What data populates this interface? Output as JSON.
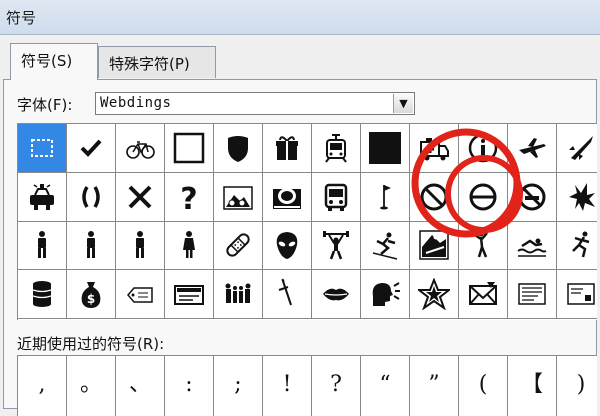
{
  "window": {
    "title": "符号"
  },
  "tabs": [
    {
      "label": "符号(S)",
      "active": true
    },
    {
      "label": "特殊字符(P)",
      "active": false
    }
  ],
  "font": {
    "label": "字体(F):",
    "value": "Webdings"
  },
  "grid": {
    "rows": [
      [
        "select-box",
        "check",
        "bicycle",
        "blank-square",
        "shield",
        "gift",
        "tram-car",
        "black-square",
        "ambulance",
        "info-circle",
        "airplane",
        "rocket",
        "compass-star"
      ],
      [
        "police-car",
        "parentheses",
        "x-mark",
        "question-mark",
        "mountain-bike",
        "postage-stamp",
        "bus",
        "golf-flag",
        "prohibit-sign",
        "no-entry-circle",
        "no-smoking",
        "burst",
        "vertical-bar"
      ],
      [
        "male",
        "male",
        "male",
        "female",
        "bandage",
        "alien",
        "weightlifter",
        "skier",
        "snowboard",
        "rock-climber",
        "swimmer",
        "sprinter",
        "motorbike"
      ],
      [
        "database",
        "money-bag",
        "price-tag",
        "ticket",
        "family",
        "sword",
        "lips",
        "speaking-head",
        "star-outline",
        "envelope",
        "news-list",
        "card",
        "inbox-tray"
      ]
    ],
    "selected_index": 0
  },
  "recent": {
    "label": "近期使用过的符号(R):",
    "items": [
      ",",
      "。",
      "、",
      ":",
      ";",
      "!",
      "?",
      "“",
      "”",
      "(",
      "【",
      ")",
      "%"
    ]
  },
  "annotation": {
    "color": "#e2231a"
  }
}
